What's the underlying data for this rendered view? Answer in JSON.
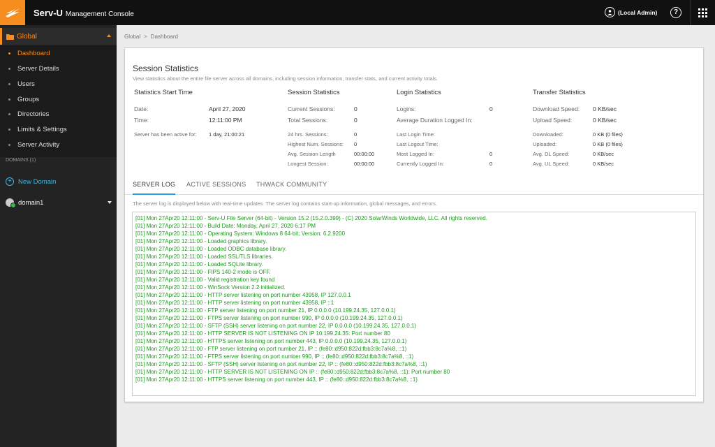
{
  "app": {
    "brand": "Serv-U",
    "subtitle": "Management Console",
    "user": "(Local Admin)",
    "help": "?",
    "brand_color": "#f68d1f"
  },
  "sidebar": {
    "global_label": "Global",
    "items": [
      {
        "label": "Dashboard",
        "active": true
      },
      {
        "label": "Server Details"
      },
      {
        "label": "Users"
      },
      {
        "label": "Groups"
      },
      {
        "label": "Directories"
      },
      {
        "label": "Limits & Settings"
      },
      {
        "label": "Server Activity"
      }
    ],
    "domains_label": "DOMAINS (1)",
    "new_domain": "New Domain",
    "domain": "domain1"
  },
  "breadcrumb": [
    "Global",
    ">",
    "Dashboard"
  ],
  "session_stats": {
    "title": "Session Statistics",
    "description": "View statistics about the entire file server across all domains, including session information, transfer stats, and current activity totals.",
    "columns": {
      "start": {
        "heading": "Statistics Start Time",
        "date_label": "Date:",
        "date_value": "April 27, 2020",
        "time_label": "Time:",
        "time_value": "12:11:00 PM",
        "active_label": "Server has been active for:",
        "active_value": "1 day, 21:00:21"
      },
      "session": {
        "heading": "Session Statistics",
        "current_label": "Current Sessions:",
        "current_value": "0",
        "total_label": "Total Sessions:",
        "total_value": "0",
        "h24_label": "24 hrs. Sessions:",
        "h24_value": "0",
        "highest_label": "Highest Num. Sessions:",
        "highest_value": "0",
        "avg_label": "Avg. Session Length",
        "avg_value": "00:00:00",
        "longest_label": "Longest Session:",
        "longest_value": "00:00:00"
      },
      "login": {
        "heading": "Login Statistics",
        "logins_label": "Logins:",
        "logins_value": "0",
        "avgdur_label": "Average Duration Logged In:",
        "lastlogin_label": "Last Login Time:",
        "lastlogout_label": "Last Logout Time:",
        "most_label": "Most Logged In:",
        "most_value": "0",
        "currently_label": "Currently Logged In:",
        "currently_value": "0"
      },
      "transfer": {
        "heading": "Transfer Statistics",
        "dl_label": "Download Speed:",
        "dl_value": "0 KB/sec",
        "ul_label": "Upload Speed:",
        "ul_value": "0 KB/sec",
        "downloaded_label": "Downloaded:",
        "downloaded_value": "0 KB (0 files)",
        "uploaded_label": "Uploaded:",
        "uploaded_value": "0 KB (0 files)",
        "avgdl_label": "Avg. DL Speed:",
        "avgdl_value": "0 KB/sec",
        "avgul_label": "Avg. UL Speed:",
        "avgul_value": "0 KB/sec"
      }
    }
  },
  "tabs": [
    {
      "label": "SERVER LOG",
      "active": true
    },
    {
      "label": "ACTIVE SESSIONS"
    },
    {
      "label": "THWACK COMMUNITY"
    }
  ],
  "log": {
    "description": "The server log is displayed below with real-time updates. The server log contains start-up information, global messages, and errors.",
    "text_color": "#1e9a1e",
    "lines": [
      "[01] Mon 27Apr20 12:11:00 - Serv-U File Server (64-bit) - Version 15.2 (15.2.0.399) - (C) 2020 SolarWinds Worldwide, LLC.  All rights reserved.",
      "[01] Mon 27Apr20 12:11:00 - Build Date: Monday, April 27, 2020 6:17 PM",
      "[01] Mon 27Apr20 12:11:00 - Operating System: Windows 8 64-bit; Version: 6.2.9200",
      "[01] Mon 27Apr20 12:11:00 - Loaded graphics library.",
      "[01] Mon 27Apr20 12:11:00 - Loaded ODBC database library.",
      "[01] Mon 27Apr20 12:11:00 - Loaded SSL/TLS libraries.",
      "[01] Mon 27Apr20 12:11:00 - Loaded SQLite library.",
      "[01] Mon 27Apr20 12:11:00 - FIPS 140-2 mode is OFF.",
      "[01] Mon 27Apr20 12:11:00 - Valid registration key found",
      "[01] Mon 27Apr20 12:11:00 - WinSock Version 2.2 initialized.",
      "[01] Mon 27Apr20 12:11:00 - HTTP server listening on port number 43958, IP 127.0.0.1",
      "[01] Mon 27Apr20 12:11:00 - HTTP server listening on port number 43958, IP ::1",
      "[01] Mon 27Apr20 12:11:00 - FTP server listening on port number 21, IP 0.0.0.0 (10.199.24.35, 127.0.0.1)",
      "[01] Mon 27Apr20 12:11:00 - FTPS server listening on port number 990, IP 0.0.0.0 (10.199.24.35, 127.0.0.1)",
      "[01] Mon 27Apr20 12:11:00 - SFTP (SSH) server listening on port number 22, IP 0.0.0.0 (10.199.24.35, 127.0.0.1)",
      "[01] Mon 27Apr20 12:11:00 - HTTP SERVER IS NOT LISTENING ON IP 10.199.24.35: Port number 80",
      "[01] Mon 27Apr20 12:11:00 - HTTPS server listening on port number 443, IP 0.0.0.0 (10.199.24.35, 127.0.0.1)",
      "[01] Mon 27Apr20 12:11:00 - FTP server listening on port number 21, IP :: (fe80::d950:822d:fbb3:8c7a%8, ::1)",
      "[01] Mon 27Apr20 12:11:00 - FTPS server listening on port number 990, IP :: (fe80::d950:822d:fbb3:8c7a%8, ::1)",
      "[01] Mon 27Apr20 12:11:00 - SFTP (SSH) server listening on port number 22, IP :: (fe80::d950:822d:fbb3:8c7a%8, ::1)",
      "[01] Mon 27Apr20 12:11:00 - HTTP SERVER IS NOT LISTENING ON IP :: (fe80::d950:822d:fbb3:8c7a%8, ::1): Port number 80",
      "[01] Mon 27Apr20 12:11:00 - HTTPS server listening on port number 443, IP :: (fe80::d950:822d:fbb3:8c7a%8, ::1)"
    ]
  }
}
